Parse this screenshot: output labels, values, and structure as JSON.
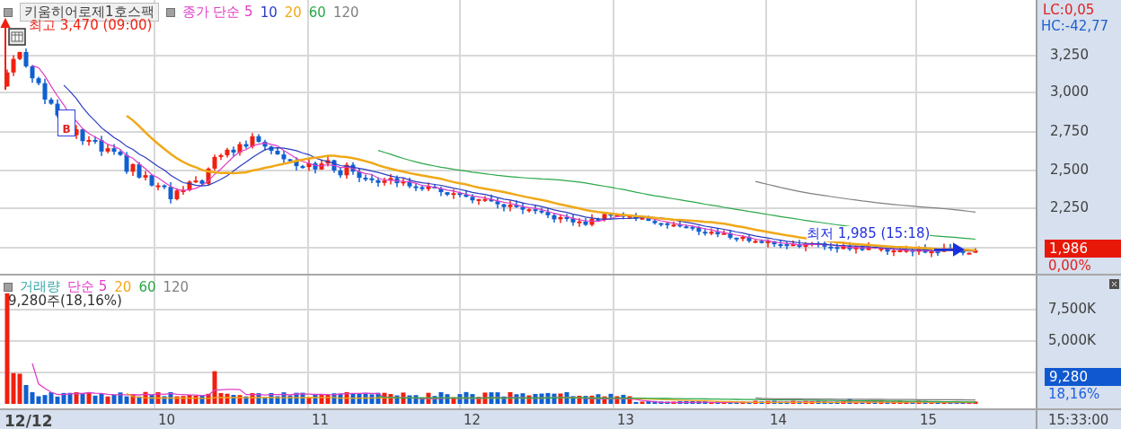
{
  "price_pane": {
    "title": "키움히어로제1호스팩",
    "legend": [
      {
        "text": "종가 단순 5",
        "color": "#e03cc8"
      },
      {
        "text": "10",
        "color": "#2a3cc0"
      },
      {
        "text": "20",
        "color": "#f0a818"
      },
      {
        "text": "60",
        "color": "#2aa848"
      },
      {
        "text": "120",
        "color": "#808080"
      }
    ],
    "high_label": "최고 3,470 (09:00)",
    "low_label": "최저 1,985 (15:18)",
    "marker": "B",
    "axis": {
      "lc": "LC:0,05",
      "hc": "HC:-42,77",
      "ticks": [
        "3,250",
        "3,000",
        "2,750",
        "2,500",
        "2,250"
      ],
      "current_price": "1,986",
      "change": "0,00%"
    }
  },
  "volume_pane": {
    "legend": [
      {
        "text": "거래량",
        "color": "#3aa8a8"
      },
      {
        "text": "단순 5",
        "color": "#e03cc8"
      },
      {
        "text": "20",
        "color": "#f0a818"
      },
      {
        "text": "60",
        "color": "#2aa848"
      },
      {
        "text": "120",
        "color": "#808080"
      }
    ],
    "info": "9,280주(18,16%)",
    "axis": {
      "ticks": [
        "7,500K",
        "5,000K"
      ],
      "current_volume": "9,280",
      "ratio": "18,16%"
    }
  },
  "x_axis": {
    "labels": [
      {
        "text": "12/12",
        "kind": "date"
      },
      {
        "text": "10",
        "kind": "day"
      },
      {
        "text": "11",
        "kind": "day"
      },
      {
        "text": "12",
        "kind": "day"
      },
      {
        "text": "13",
        "kind": "day"
      },
      {
        "text": "14",
        "kind": "day"
      },
      {
        "text": "15",
        "kind": "day"
      }
    ],
    "time": "15:33:00"
  }
}
